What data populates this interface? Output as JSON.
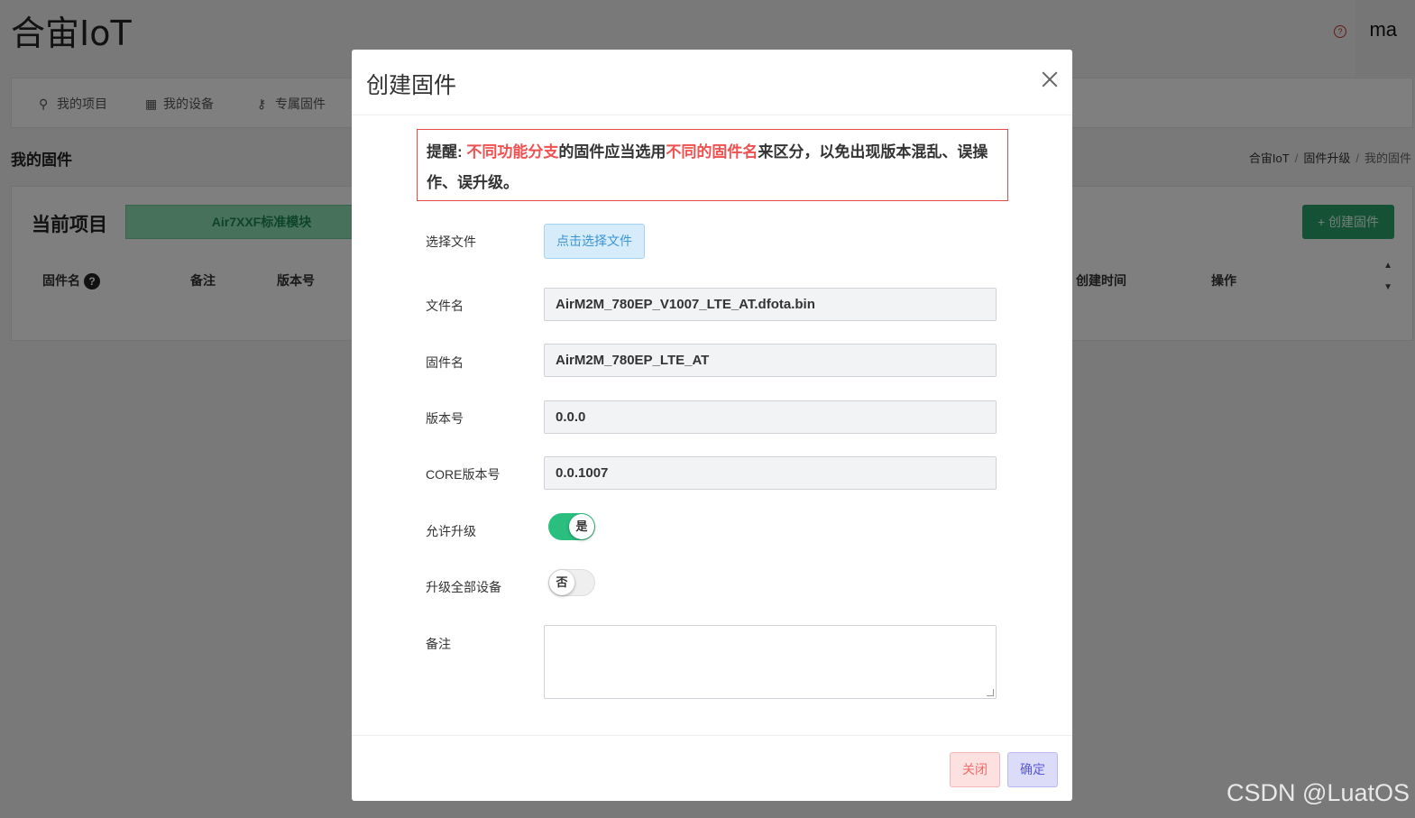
{
  "app": {
    "title": "合宙IoT",
    "user": "ma",
    "help_glyph": "?"
  },
  "nav": {
    "items": [
      {
        "label": "我的项目",
        "icon": "lightbulb-icon"
      },
      {
        "label": "我的设备",
        "icon": "chip-icon"
      },
      {
        "label": "专属固件",
        "icon": "key-icon"
      }
    ]
  },
  "page": {
    "heading": "我的固件",
    "breadcrumb": [
      "合宙IoT",
      "固件升级",
      "我的固件"
    ]
  },
  "card": {
    "current_label": "当前项目",
    "project": "Air7XXF标准模块",
    "create_button": "+ 创建固件",
    "columns": [
      "固件名",
      "备注",
      "版本号",
      "创建时间",
      "操作"
    ]
  },
  "modal": {
    "title": "创建固件",
    "warning": {
      "prefix": "提醒: ",
      "red1": "不同功能分支",
      "mid1": "的固件应当选用",
      "red2": "不同的固件名",
      "mid2": "来区分，以免出现版本混乱、误操作、误升级。"
    },
    "fields": {
      "select_file_label": "选择文件",
      "select_file_button": "点击选择文件",
      "filename_label": "文件名",
      "filename_value": "AirM2M_780EP_V1007_LTE_AT.dfota.bin",
      "firmware_label": "固件名",
      "firmware_value": "AirM2M_780EP_LTE_AT",
      "version_label": "版本号",
      "version_value": "0.0.0",
      "core_label": "CORE版本号",
      "core_value": "0.0.1007",
      "allow_upgrade_label": "允许升级",
      "allow_upgrade_value": "是",
      "upgrade_all_label": "升级全部设备",
      "upgrade_all_value": "否",
      "remark_label": "备注"
    },
    "footer": {
      "close": "关闭",
      "confirm": "确定"
    }
  },
  "watermark": "CSDN @LuatOS",
  "colors": {
    "accent_green": "#2aa36b",
    "warning_red": "#f05050",
    "toggle_on": "#2bbf7f"
  }
}
